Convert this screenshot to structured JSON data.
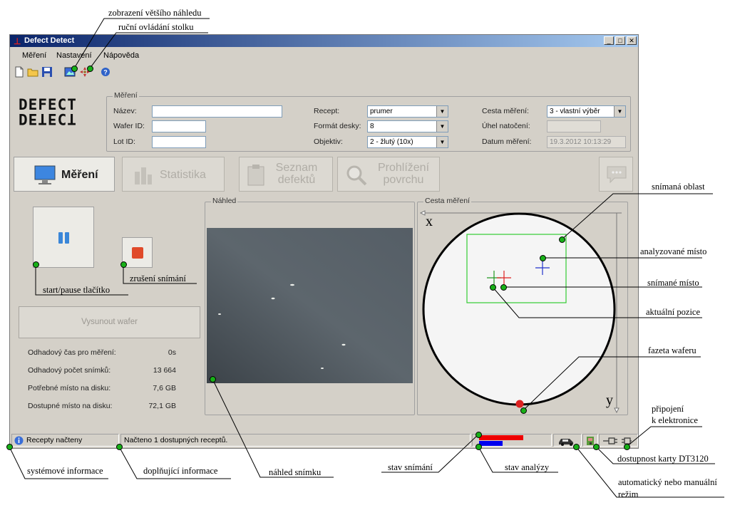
{
  "window": {
    "title": "Defect Detect",
    "menu": [
      "Měření",
      "Nastavení",
      "Nápověda"
    ],
    "logo_top": "DEFECT",
    "logo_bottom": "DETECT"
  },
  "measurement": {
    "legend": "Měření",
    "name_label": "Název:",
    "name_value": "",
    "wafer_label": "Wafer ID:",
    "wafer_value": "",
    "lot_label": "Lot ID:",
    "lot_value": "",
    "recipe_label": "Recept:",
    "recipe_value": "prumer",
    "format_label": "Formát desky:",
    "format_value": "8",
    "objective_label": "Objektiv:",
    "objective_value": "2 - žlutý (10x)",
    "path_label": "Cesta měření:",
    "path_value": "3 - vlastní výběr",
    "angle_label": "Úhel natočení:",
    "angle_value": "",
    "date_label": "Datum měření:",
    "date_value": "19.3.2012 10:13:29"
  },
  "tabs": {
    "mereni": "Měření",
    "statistika": "Statistika",
    "seznam_1": "Seznam",
    "seznam_2": "defektů",
    "prohlizeni_1": "Prohlížení",
    "prohlizeni_2": "povrchu"
  },
  "controls": {
    "eject": "Vysunout wafer"
  },
  "info": [
    {
      "label": "Odhadový čas pro měření:",
      "value": "0s"
    },
    {
      "label": "Odhadový počet snímků:",
      "value": "13 664"
    },
    {
      "label": "Potřebné místo na disku:",
      "value": "7,6 GB"
    },
    {
      "label": "Dostupné místo na disku:",
      "value": "72,1 GB"
    }
  ],
  "preview": {
    "legend": "Náhled"
  },
  "path": {
    "legend": "Cesta měření",
    "x_axis": "x",
    "y_axis": "y"
  },
  "status": {
    "left": "Recepty načteny",
    "middle": "Načteno 1 dostupných receptů.",
    "scan_progress": 0.82,
    "analysis_progress": 0.44,
    "scan_color": "#ee0000",
    "analysis_color": "#0000ee"
  },
  "annotations": {
    "larger_preview": "zobrazení většího náhledu",
    "manual_stage": "ruční ovládání stolku",
    "start_pause": "start/pause tlačítko",
    "cancel_scan": "zrušení snímání",
    "scanned_area": "snímaná oblast",
    "analyzed_place": "analyzované místo",
    "scanned_place": "snímané místo",
    "current_position": "aktuální pozice",
    "wafer_facet": "fazeta waferu",
    "connection_1": "připojení",
    "connection_2": "k elektronice",
    "card_availability": "dostupnost karty DT3120",
    "mode_1": "automatický nebo manuální",
    "mode_2": "režim",
    "analysis_state": "stav analýzy",
    "scan_state": "stav snímání",
    "image_preview": "náhled snímku",
    "additional_info": "doplňující informace",
    "system_info": "systémové informace"
  },
  "colors": {
    "accent_green": "#18b018",
    "titlebar": "#0a246a"
  }
}
